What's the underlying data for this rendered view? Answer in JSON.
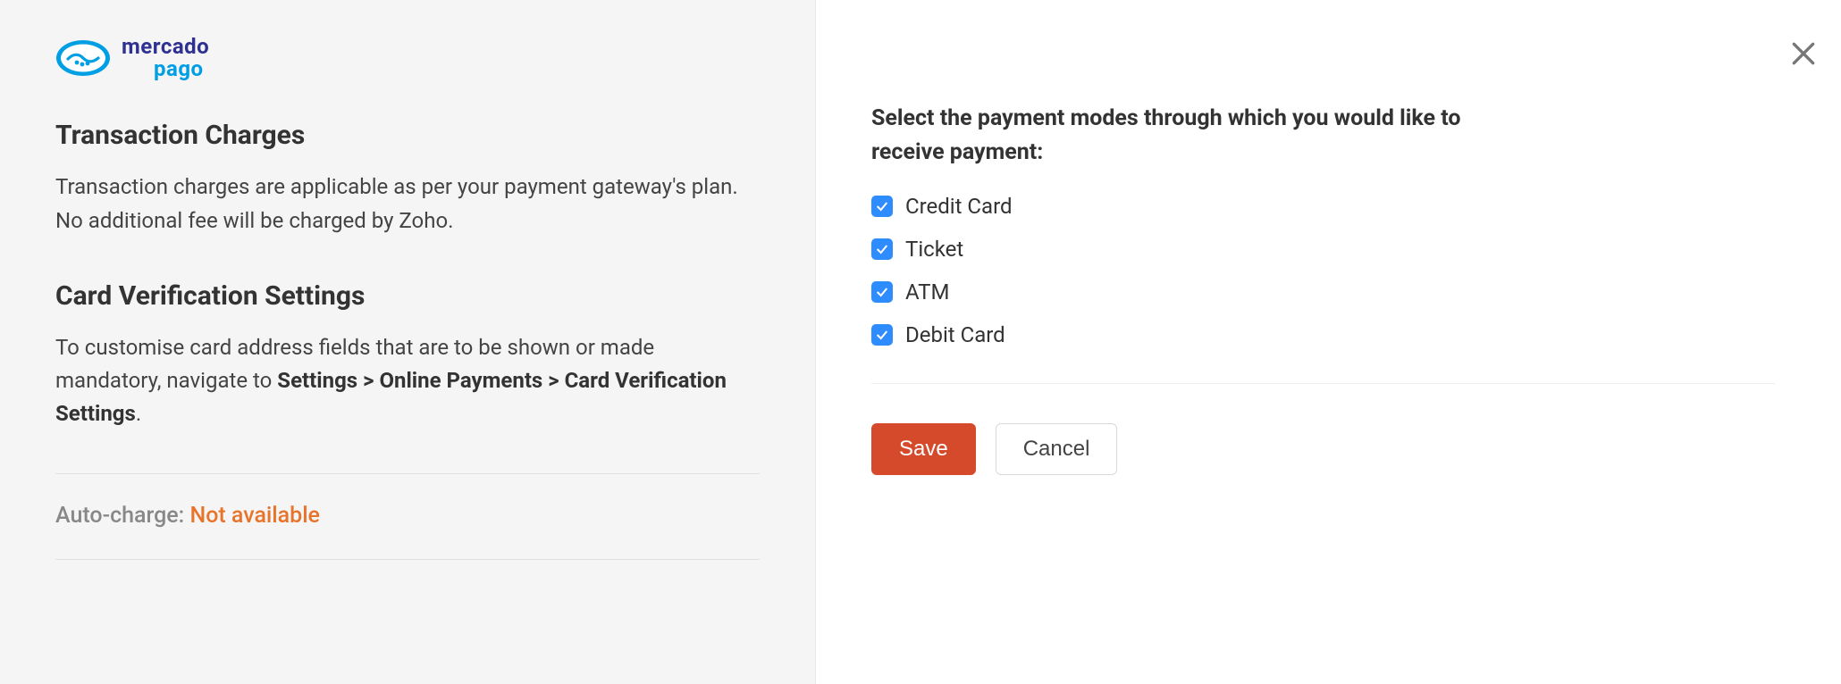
{
  "logo": {
    "line1": "mercado",
    "line2": "pago"
  },
  "left": {
    "transaction_title": "Transaction Charges",
    "transaction_text": "Transaction charges are applicable as per your payment gateway's plan. No additional fee will be charged by Zoho.",
    "card_title": "Card Verification Settings",
    "card_text_prefix": "To customise card address fields that are to be shown or made mandatory, navigate to ",
    "card_text_bold": "Settings > Online Payments > Card Verification Settings",
    "card_text_suffix": ".",
    "auto_charge_label": "Auto-charge: ",
    "auto_charge_value": "Not available"
  },
  "right": {
    "heading": "Select the payment modes through which you would like to receive payment:",
    "options": [
      {
        "label": "Credit Card",
        "checked": true
      },
      {
        "label": "Ticket",
        "checked": true
      },
      {
        "label": "ATM",
        "checked": true
      },
      {
        "label": "Debit Card",
        "checked": true
      }
    ],
    "save_label": "Save",
    "cancel_label": "Cancel"
  }
}
